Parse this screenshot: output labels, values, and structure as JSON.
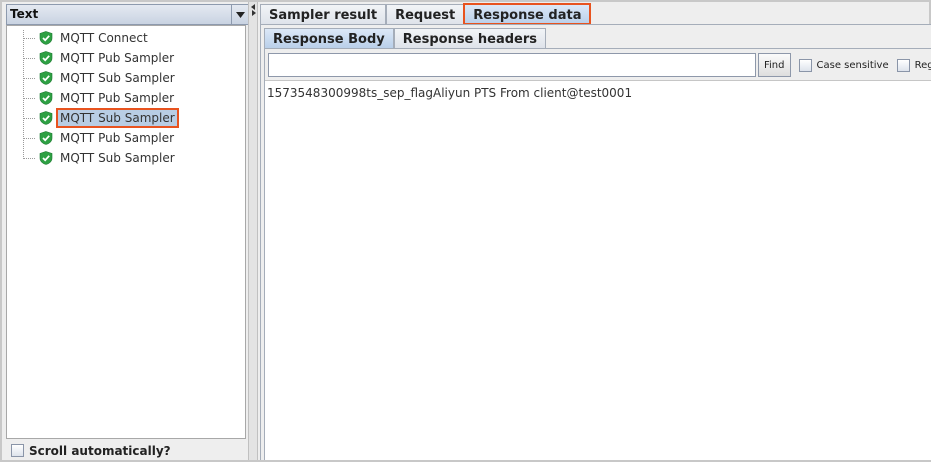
{
  "left_panel": {
    "renderer_combo": "Text",
    "tree_items": [
      {
        "label": "MQTT Connect",
        "selected": false
      },
      {
        "label": "MQTT Pub Sampler",
        "selected": false
      },
      {
        "label": "MQTT Sub Sampler",
        "selected": false
      },
      {
        "label": "MQTT Pub Sampler",
        "selected": false
      },
      {
        "label": "MQTT Sub Sampler",
        "selected": true
      },
      {
        "label": "MQTT Pub Sampler",
        "selected": false
      },
      {
        "label": "MQTT Sub Sampler",
        "selected": false
      }
    ],
    "node_icon": "shield-check-icon",
    "scroll_auto_label": "Scroll automatically?"
  },
  "right_panel": {
    "main_tabs": [
      {
        "label": "Sampler result",
        "active": false
      },
      {
        "label": "Request",
        "active": false
      },
      {
        "label": "Response data",
        "active": true
      }
    ],
    "sub_tabs": [
      {
        "label": "Response Body",
        "active": true
      },
      {
        "label": "Response headers",
        "active": false
      }
    ],
    "search": {
      "value": "",
      "find_label": "Find",
      "case_sensitive_label": "Case sensitive",
      "regex_label": "Reg"
    },
    "response_body": "1573548300998ts_sep_flagAliyun PTS From client@test0001"
  },
  "colors": {
    "highlight_outline": "#e8531f",
    "selection_bg": "#b8cde4",
    "success_icon": "#2ea043"
  }
}
